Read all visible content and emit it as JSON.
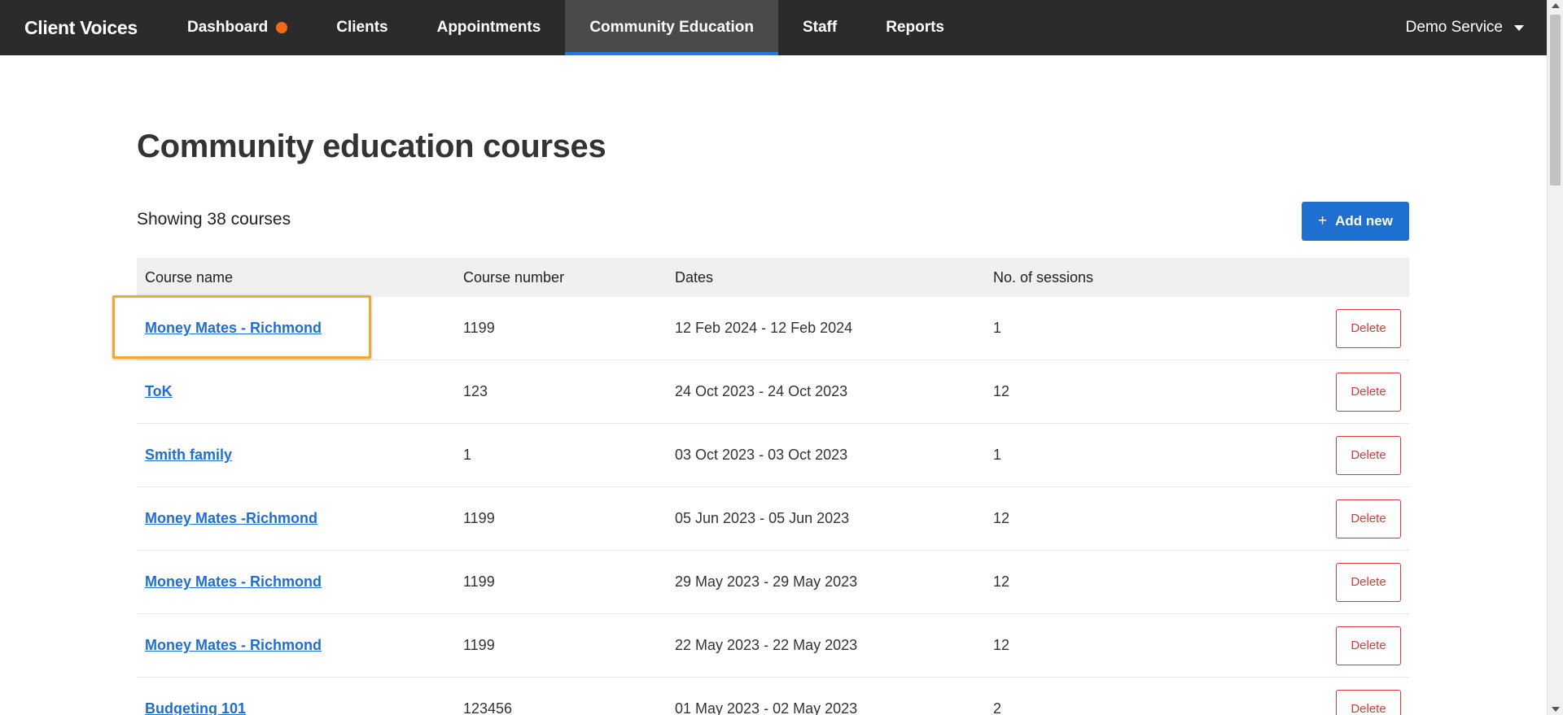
{
  "app": {
    "name": "Client Voices"
  },
  "nav": {
    "items": [
      {
        "label": "Dashboard",
        "has_dot": true
      },
      {
        "label": "Clients"
      },
      {
        "label": "Appointments"
      },
      {
        "label": "Community Education",
        "active": true
      },
      {
        "label": "Staff"
      },
      {
        "label": "Reports"
      }
    ],
    "account": "Demo Service"
  },
  "page": {
    "title": "Community education courses",
    "showing": "Showing 38 courses",
    "add_button": "Add new"
  },
  "table": {
    "headers": [
      "Course name",
      "Course number",
      "Dates",
      "No. of sessions"
    ],
    "rows": [
      {
        "name": "Money Mates - Richmond",
        "number": "1199",
        "dates": "12 Feb 2024 - 12 Feb 2024",
        "sessions": "1",
        "delete": "Delete"
      },
      {
        "name": "ToK",
        "number": "123",
        "dates": "24 Oct 2023 - 24 Oct 2023",
        "sessions": "12",
        "delete": "Delete"
      },
      {
        "name": "Smith family",
        "number": "1",
        "dates": "03 Oct 2023 - 03 Oct 2023",
        "sessions": "1",
        "delete": "Delete"
      },
      {
        "name": "Money Mates -Richmond",
        "number": "1199",
        "dates": "05 Jun 2023 - 05 Jun 2023",
        "sessions": "12",
        "delete": "Delete"
      },
      {
        "name": "Money Mates - Richmond",
        "number": "1199",
        "dates": "29 May 2023 - 29 May 2023",
        "sessions": "12",
        "delete": "Delete"
      },
      {
        "name": "Money Mates - Richmond",
        "number": "1199",
        "dates": "22 May 2023 - 22 May 2023",
        "sessions": "12",
        "delete": "Delete"
      },
      {
        "name": "Budgeting 101",
        "number": "123456",
        "dates": "01 May 2023 - 02 May 2023",
        "sessions": "2",
        "delete": "Delete"
      }
    ]
  },
  "colors": {
    "nav_bg": "#2b2b2b",
    "accent": "#1f6fd0",
    "danger": "#d63a3a",
    "notification_dot": "#f06a1e",
    "highlight": "#f0a830"
  }
}
